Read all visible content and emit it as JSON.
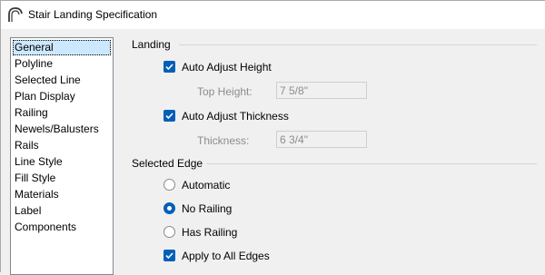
{
  "window": {
    "title": "Stair Landing Specification",
    "icon": "stair-arch-icon"
  },
  "nav": {
    "items": [
      {
        "label": "General",
        "selected": true
      },
      {
        "label": "Polyline",
        "selected": false
      },
      {
        "label": "Selected Line",
        "selected": false
      },
      {
        "label": "Plan Display",
        "selected": false
      },
      {
        "label": "Railing",
        "selected": false
      },
      {
        "label": "Newels/Balusters",
        "selected": false
      },
      {
        "label": "Rails",
        "selected": false
      },
      {
        "label": "Line Style",
        "selected": false
      },
      {
        "label": "Fill Style",
        "selected": false
      },
      {
        "label": "Materials",
        "selected": false
      },
      {
        "label": "Label",
        "selected": false
      },
      {
        "label": "Components",
        "selected": false
      }
    ]
  },
  "landing": {
    "heading": "Landing",
    "auto_adjust_height": {
      "label": "Auto Adjust Height",
      "checked": true
    },
    "top_height": {
      "label": "Top Height:",
      "value": "7 5/8\"",
      "enabled": false
    },
    "auto_adjust_thickness": {
      "label": "Auto Adjust Thickness",
      "checked": true
    },
    "thickness": {
      "label": "Thickness:",
      "value": "6 3/4\"",
      "enabled": false
    }
  },
  "selected_edge": {
    "heading": "Selected Edge",
    "options": [
      {
        "label": "Automatic",
        "checked": false
      },
      {
        "label": "No Railing",
        "checked": true
      },
      {
        "label": "Has Railing",
        "checked": false
      }
    ],
    "apply_all": {
      "label": "Apply to All Edges",
      "checked": true
    }
  },
  "colors": {
    "accent": "#005fb8",
    "selection": "#cce8ff",
    "disabled_text": "#8c8c8c"
  }
}
